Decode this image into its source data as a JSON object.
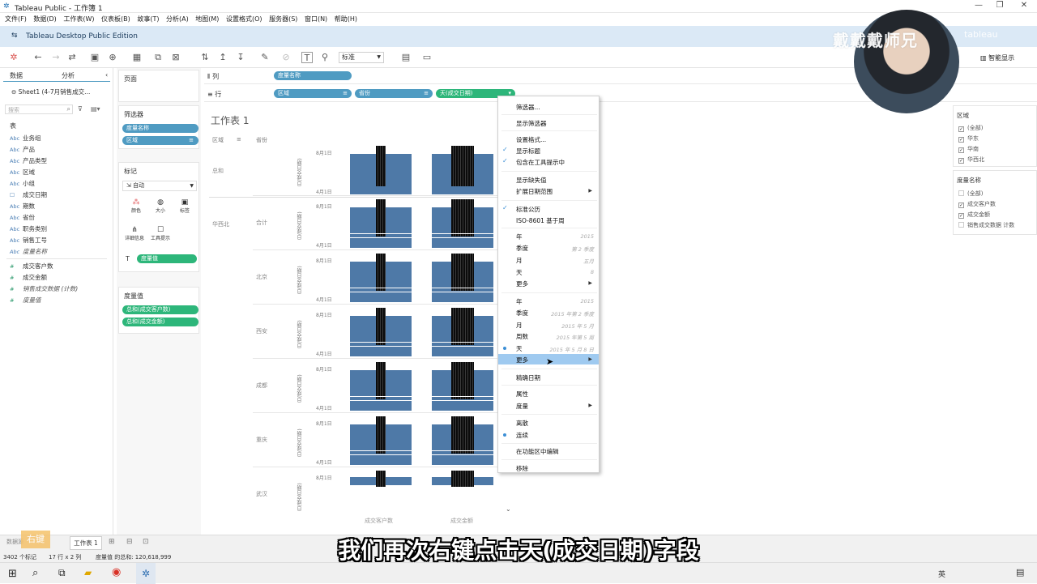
{
  "window": {
    "title": "Tableau Public - 工作簿 1",
    "edition": "Tableau Desktop Public Edition",
    "controls": [
      "—",
      "❐",
      "✕"
    ]
  },
  "menu": [
    "文件(F)",
    "数据(D)",
    "工作表(W)",
    "仪表板(B)",
    "故事(T)",
    "分析(A)",
    "地图(M)",
    "设置格式(O)",
    "服务器(S)",
    "窗口(N)",
    "帮助(H)"
  ],
  "toolbar": {
    "fit": "标准",
    "smart_show": "智能显示"
  },
  "watermark": {
    "text": "戴戴戴师兄",
    "brand": "tableau"
  },
  "left": {
    "tabs": [
      "数据",
      "分析"
    ],
    "datasource": "Sheet1 (4-7月销售成交...",
    "search_placeholder": "搜索",
    "section": "表",
    "fields": [
      {
        "type": "Abc",
        "name": "业务组"
      },
      {
        "type": "Abc",
        "name": "产品"
      },
      {
        "type": "Abc",
        "name": "产品类型"
      },
      {
        "type": "Abc",
        "name": "区域"
      },
      {
        "type": "Abc",
        "name": "小组"
      },
      {
        "type": "☐",
        "name": "成交日期"
      },
      {
        "type": "Abc",
        "name": "期数"
      },
      {
        "type": "Abc",
        "name": "省份"
      },
      {
        "type": "Abc",
        "name": "职务类别"
      },
      {
        "type": "Abc",
        "name": "销售工号"
      },
      {
        "type": "Abc",
        "name": "度量名称"
      },
      {
        "type": "#",
        "name": "成交客户数"
      },
      {
        "type": "#",
        "name": "成交金额"
      },
      {
        "type": "#",
        "name": "销售成交数据 (计数)"
      },
      {
        "type": "#",
        "name": "度量值"
      }
    ]
  },
  "cards": {
    "pages": "页面",
    "filters": {
      "title": "筛选器",
      "items": [
        "度量名称",
        "区域"
      ]
    },
    "marks": {
      "title": "标记",
      "type": "自动",
      "buttons": [
        "颜色",
        "大小",
        "标签",
        "详细信息",
        "工具提示"
      ],
      "pill": "度量值"
    },
    "measure_values": {
      "title": "度量值",
      "items": [
        "总和(成交客户数)",
        "总和(成交金额)"
      ]
    }
  },
  "shelves": {
    "columns_label": "列",
    "rows_label": "行",
    "columns": [
      "度量名称"
    ],
    "rows": [
      "区域",
      "省份",
      "天(成交日期)"
    ]
  },
  "viz": {
    "title": "工作表 1",
    "headers": [
      "区域",
      "省份"
    ],
    "region_labels": [
      "总和",
      "华西北"
    ],
    "province_labels": [
      "合计",
      "北京",
      "西安",
      "成都",
      "重庆",
      "武汉"
    ],
    "axis_title": "日(成交日期) [2020年]",
    "axis_ticks": [
      "8月1日",
      "4月1日"
    ],
    "x_labels": [
      "成交客户数",
      "成交金额"
    ]
  },
  "context_menu": {
    "items": [
      {
        "label": "筛选器..."
      },
      {
        "label": "显示筛选器"
      },
      {
        "label": "设置格式..."
      },
      {
        "label": "显示标题",
        "checked": true
      },
      {
        "label": "包含在工具提示中",
        "checked": true
      },
      {
        "label": "显示缺失值"
      },
      {
        "label": "扩展日期范围",
        "submenu": true
      },
      {
        "label": "标准公历",
        "checked": true
      },
      {
        "label": "ISO-8601 基于周"
      },
      {
        "label": "年",
        "hint": "2015"
      },
      {
        "label": "季度",
        "hint": "第 2 季度"
      },
      {
        "label": "月",
        "hint": "五月"
      },
      {
        "label": "天",
        "hint": "8"
      },
      {
        "label": "更多",
        "submenu": true
      },
      {
        "label": "年",
        "hint": "2015"
      },
      {
        "label": "季度",
        "hint": "2015 年第 2 季度"
      },
      {
        "label": "月",
        "hint": "2015 年 5 月"
      },
      {
        "label": "周数",
        "hint": "2015 年第 5 周"
      },
      {
        "label": "天",
        "hint": "2015 年 5 月 8 日",
        "selected": true
      },
      {
        "label": "更多",
        "submenu": true,
        "highlighted": true
      },
      {
        "label": "精确日期"
      },
      {
        "label": "属性"
      },
      {
        "label": "度量",
        "submenu": true
      },
      {
        "label": "离散"
      },
      {
        "label": "连续",
        "selected": true
      },
      {
        "label": "在功能区中编辑"
      },
      {
        "label": "移除"
      }
    ]
  },
  "legends": {
    "region": {
      "title": "区域",
      "items": [
        {
          "label": "(全部)",
          "checked": true
        },
        {
          "label": "华东",
          "checked": true
        },
        {
          "label": "华南",
          "checked": true
        },
        {
          "label": "华西北",
          "checked": true
        }
      ]
    },
    "measure": {
      "title": "度量名称",
      "items": [
        {
          "label": "(全部)",
          "checked": false
        },
        {
          "label": "成交客户数",
          "checked": true
        },
        {
          "label": "成交金额",
          "checked": true
        },
        {
          "label": "销售成交数据 计数",
          "checked": false
        }
      ]
    }
  },
  "sheet_tabs": {
    "badge": "右键",
    "data_source": "数据源",
    "active": "工作表 1"
  },
  "status": {
    "marks": "3402 个标记",
    "dims": "17 行 x 2 列",
    "sum": "度量值 的总和: 120,618,999"
  },
  "subtitle": "我们再次右键点击天(成交日期)字段",
  "taskbar": {
    "time_lang": "英"
  }
}
